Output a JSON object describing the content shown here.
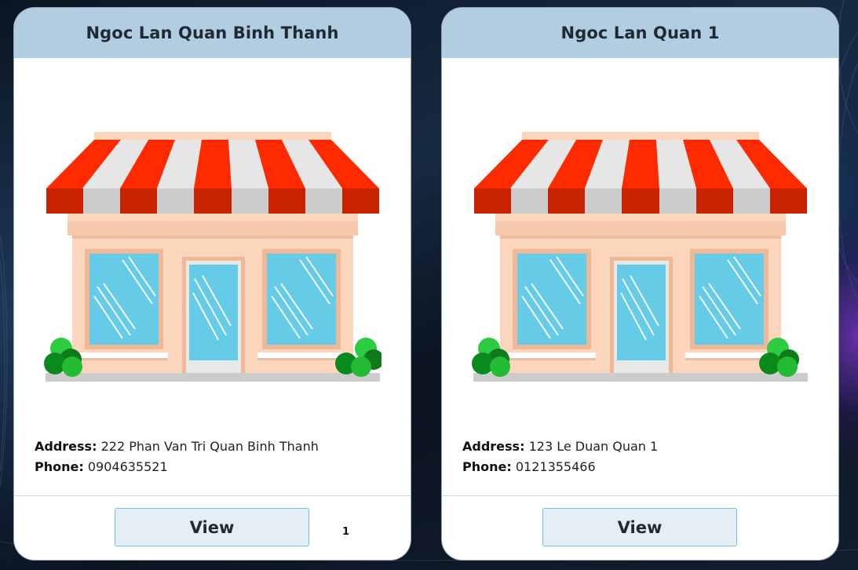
{
  "cards": [
    {
      "title": "Ngoc Lan Quan Binh Thanh",
      "image_icon": "store-front-icon",
      "address_label": "Address:",
      "address_value": "222 Phan Van Tri Quan Binh Thanh",
      "phone_label": "Phone:",
      "phone_value": "0904635521",
      "button_label": "View"
    },
    {
      "title": "Ngoc Lan Quan 1",
      "image_icon": "store-front-icon",
      "address_label": "Address:",
      "address_value": "123 Le Duan Quan 1",
      "phone_label": "Phone:",
      "phone_value": "0121355466",
      "button_label": "View"
    }
  ],
  "pagination": {
    "current_page": "1"
  },
  "colors": {
    "header_bg": "#b3cde0",
    "button_bg": "#e6eef5",
    "button_border": "#6fc0dc",
    "awning_red": "#ff2a00",
    "awning_white": "#e6e6e6",
    "wall": "#fcd6bc",
    "glass": "#66cbe6",
    "bush": "#22aa22"
  }
}
